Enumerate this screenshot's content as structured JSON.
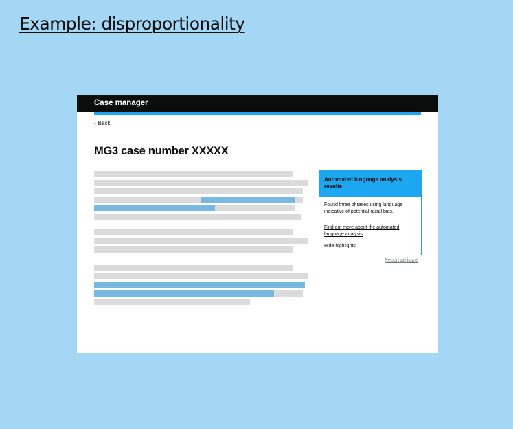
{
  "slide": {
    "title": "Example: disproportionality"
  },
  "app": {
    "name": "Case manager",
    "back_link": "Back",
    "back_icon": "chevron-left-icon",
    "page_title": "MG3 case number XXXXX",
    "colors": {
      "background": "#a3d7f5",
      "header": "#0b0c0c",
      "accent": "#1da7f0",
      "highlight": "#79b8df",
      "placeholder_text": "#dbdbdb"
    }
  },
  "analysis_panel": {
    "title": "Automated language analysis results",
    "summary": "Found three phrases using language indicative of potential racial bias.",
    "more_link": "Find out more about the automated language analysis",
    "hide_link": "Hide highlights"
  },
  "report_link": "Report an issue"
}
